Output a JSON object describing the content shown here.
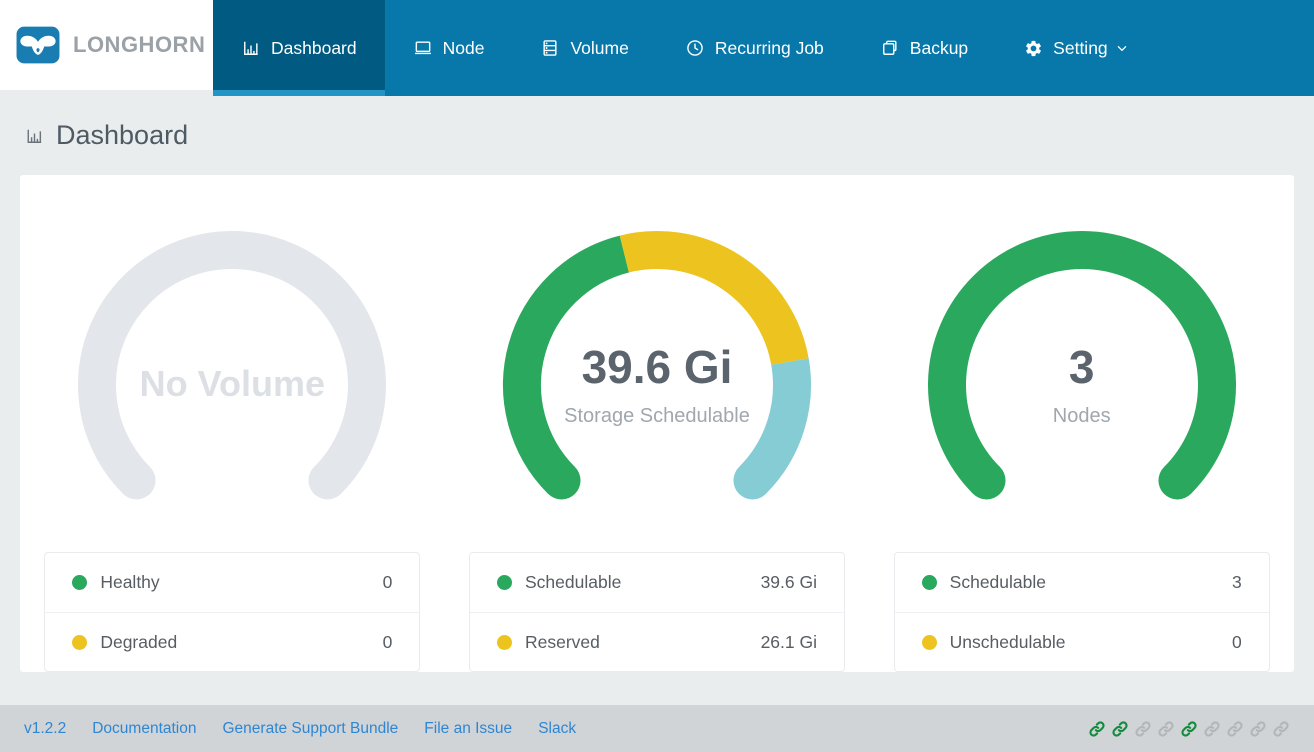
{
  "brand": {
    "name": "LONGHORN"
  },
  "nav": {
    "items": [
      {
        "label": "Dashboard",
        "icon": "bar-chart-icon",
        "active": true
      },
      {
        "label": "Node",
        "icon": "laptop-icon",
        "active": false
      },
      {
        "label": "Volume",
        "icon": "server-stack-icon",
        "active": false
      },
      {
        "label": "Recurring Job",
        "icon": "clock-icon",
        "active": false
      },
      {
        "label": "Backup",
        "icon": "copy-icon",
        "active": false
      },
      {
        "label": "Setting",
        "icon": "gear-icon",
        "active": false,
        "has_dropdown": true
      }
    ]
  },
  "page": {
    "title": "Dashboard"
  },
  "chart_data": [
    {
      "type": "gauge",
      "title": "Volume",
      "center_label": "No Volume",
      "center_sublabel": "",
      "arc_total_deg": 270,
      "segments": [
        {
          "color": "#e3e6ea",
          "sweep_deg": 270
        }
      ],
      "legend": [
        {
          "label": "Healthy",
          "color": "#2aa85e",
          "value": "0"
        },
        {
          "label": "Degraded",
          "color": "#edc41f",
          "value": "0",
          "partially_clipped": true
        }
      ]
    },
    {
      "type": "gauge",
      "title": "Storage Schedulable",
      "center_label": "39.6 Gi",
      "center_sublabel": "Storage Schedulable",
      "arc_total_deg": 270,
      "segments": [
        {
          "label": "Schedulable",
          "color": "#2aa85e",
          "value": "39.6 Gi",
          "sweep_deg": 121
        },
        {
          "label": "Reserved",
          "color": "#edc41f",
          "value": "26.1 Gi",
          "sweep_deg": 94
        },
        {
          "color": "#85ccd5",
          "sweep_deg": 55
        }
      ],
      "legend": [
        {
          "label": "Schedulable",
          "color": "#2aa85e",
          "value": "39.6 Gi"
        },
        {
          "label": "Reserved",
          "color": "#edc41f",
          "value": "26.1 Gi",
          "partially_clipped": true
        }
      ]
    },
    {
      "type": "gauge",
      "title": "Nodes",
      "center_label": "3",
      "center_sublabel": "Nodes",
      "arc_total_deg": 270,
      "segments": [
        {
          "label": "Schedulable",
          "color": "#2aa85e",
          "value": "3",
          "sweep_deg": 270
        }
      ],
      "legend": [
        {
          "label": "Schedulable",
          "color": "#2aa85e",
          "value": "3"
        },
        {
          "label": "Unschedulable",
          "color": "#edc41f",
          "value": "0",
          "partially_clipped": true
        }
      ]
    }
  ],
  "footer": {
    "version": "v1.2.2",
    "links": [
      {
        "label": "Documentation"
      },
      {
        "label": "Generate Support Bundle"
      },
      {
        "label": "File an Issue"
      },
      {
        "label": "Slack"
      }
    ],
    "connection_icons": [
      "green",
      "green",
      "gray",
      "gray",
      "green",
      "gray",
      "gray",
      "gray",
      "gray"
    ]
  },
  "colors": {
    "nav_background": "#0778a9",
    "nav_active_background": "#005a81",
    "nav_active_underline": "#2095c6",
    "healthy_green": "#2aa85e",
    "warning_yellow": "#edc41f",
    "used_blue": "#85ccd5",
    "empty_gray": "#e3e6ea",
    "link_blue": "#2e86d3",
    "chain_green": "#118a3d",
    "chain_gray": "#b2b6b9"
  }
}
